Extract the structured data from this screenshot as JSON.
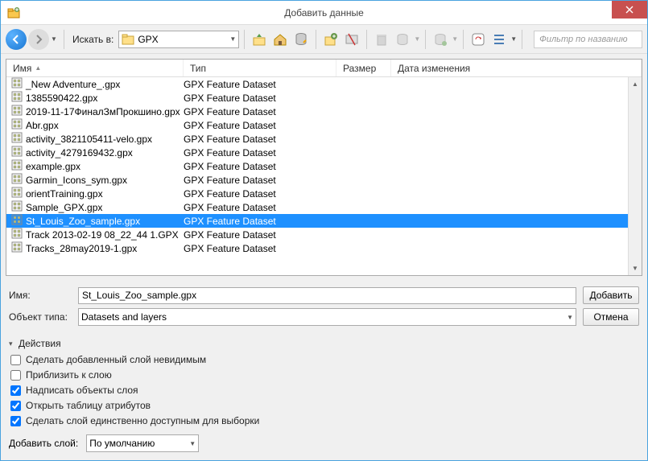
{
  "window": {
    "title": "Добавить данные"
  },
  "toolbar": {
    "look_in_label": "Искать в:",
    "look_in_value": "GPX",
    "filter_placeholder": "Фильтр по названию"
  },
  "columns": {
    "name": "Имя",
    "type": "Тип",
    "size": "Размер",
    "date": "Дата изменения"
  },
  "files": [
    {
      "name": "_New Adventure_.gpx",
      "type": "GPX Feature Dataset",
      "selected": false
    },
    {
      "name": "1385590422.gpx",
      "type": "GPX Feature Dataset",
      "selected": false
    },
    {
      "name": "2019-11-17ФиналЗмПрокшино.gpx",
      "type": "GPX Feature Dataset",
      "selected": false
    },
    {
      "name": "Abr.gpx",
      "type": "GPX Feature Dataset",
      "selected": false
    },
    {
      "name": "activity_3821105411-velo.gpx",
      "type": "GPX Feature Dataset",
      "selected": false
    },
    {
      "name": "activity_4279169432.gpx",
      "type": "GPX Feature Dataset",
      "selected": false
    },
    {
      "name": "example.gpx",
      "type": "GPX Feature Dataset",
      "selected": false
    },
    {
      "name": "Garmin_Icons_sym.gpx",
      "type": "GPX Feature Dataset",
      "selected": false
    },
    {
      "name": "orientTraining.gpx",
      "type": "GPX Feature Dataset",
      "selected": false
    },
    {
      "name": "Sample_GPX.gpx",
      "type": "GPX Feature Dataset",
      "selected": false
    },
    {
      "name": "St_Louis_Zoo_sample.gpx",
      "type": "GPX Feature Dataset",
      "selected": true
    },
    {
      "name": "Track 2013-02-19 08_22_44 1.GPX",
      "type": "GPX Feature Dataset",
      "selected": false
    },
    {
      "name": "Tracks_28may2019-1.gpx",
      "type": "GPX Feature Dataset",
      "selected": false
    }
  ],
  "inputs": {
    "name_label": "Имя:",
    "name_value": "St_Louis_Zoo_sample.gpx",
    "type_label": "Объект типа:",
    "type_value": "Datasets and layers",
    "add_btn": "Добавить",
    "cancel_btn": "Отмена"
  },
  "actions": {
    "header": "Действия",
    "opts": [
      {
        "label": "Сделать добавленный слой невидимым",
        "checked": false
      },
      {
        "label": "Приблизить к слою",
        "checked": false
      },
      {
        "label": "Надписать объекты слоя",
        "checked": true
      },
      {
        "label": "Открыть таблицу атрибутов",
        "checked": true
      },
      {
        "label": "Сделать слой единственно доступным для выборки",
        "checked": true
      }
    ],
    "addlayer_label": "Добавить слой:",
    "addlayer_value": "По умолчанию"
  }
}
